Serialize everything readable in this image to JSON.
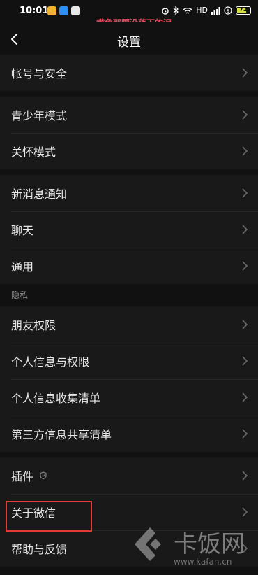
{
  "status_bar": {
    "time": "10:01",
    "wifi_icon": "wifi-icon",
    "network_label": "HD",
    "battery_level": "72"
  },
  "overlay_caption": "嘴角那颗没落下的泪",
  "header": {
    "title": "设置",
    "back_icon": "chevron-left-icon"
  },
  "groups": [
    {
      "items": [
        {
          "label": "帐号与安全"
        }
      ]
    },
    {
      "items": [
        {
          "label": "青少年模式"
        },
        {
          "label": "关怀模式"
        }
      ]
    },
    {
      "items": [
        {
          "label": "新消息通知"
        },
        {
          "label": "聊天"
        },
        {
          "label": "通用"
        }
      ]
    }
  ],
  "privacy": {
    "section_label": "隐私",
    "items": [
      {
        "label": "朋友权限"
      },
      {
        "label": "个人信息与权限"
      },
      {
        "label": "个人信息收集清单"
      },
      {
        "label": "第三方信息共享清单"
      }
    ]
  },
  "more": {
    "items": [
      {
        "label": "插件",
        "tail_icon": "shield-icon"
      },
      {
        "label": "关于微信"
      },
      {
        "label": "帮助与反馈"
      }
    ]
  },
  "watermark": {
    "brand": "卡饭网",
    "url": "www.kafan.cn"
  },
  "colors": {
    "background": "#111111",
    "row_background": "#191919",
    "highlight": "#e53935",
    "caption": "#e0485d"
  }
}
